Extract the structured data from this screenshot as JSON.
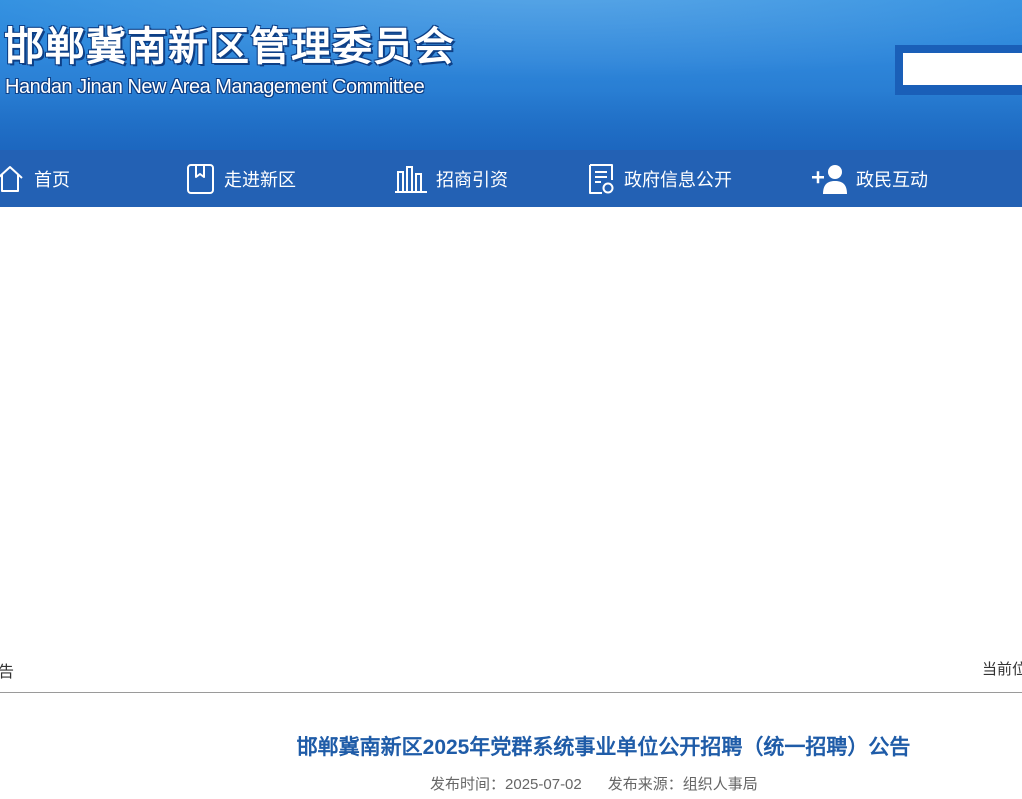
{
  "header": {
    "title": "邯郸冀南新区管理委员会",
    "subtitle": "Handan Jinan New Area Management Committee",
    "search_placeholder": ""
  },
  "nav": {
    "items": [
      {
        "label": "首页",
        "icon": "home-icon"
      },
      {
        "label": "走进新区",
        "icon": "bookmark-icon"
      },
      {
        "label": "招商引资",
        "icon": "bar-chart-icon"
      },
      {
        "label": "政府信息公开",
        "icon": "document-icon"
      },
      {
        "label": "政民互动",
        "icon": "add-user-icon"
      }
    ]
  },
  "breadcrumb": {
    "left": "公告",
    "right": "当前位"
  },
  "article": {
    "title": "邯郸冀南新区2025年党群系统事业单位公开招聘（统一招聘）公告",
    "publish_time_label": "发布时间：",
    "publish_time": "2025-07-02",
    "source_label": "发布来源：",
    "source": "组织人事局"
  },
  "colors": {
    "header_blue": "#2e86da",
    "nav_blue": "#2361b4",
    "title_blue": "#1f5ca8"
  }
}
